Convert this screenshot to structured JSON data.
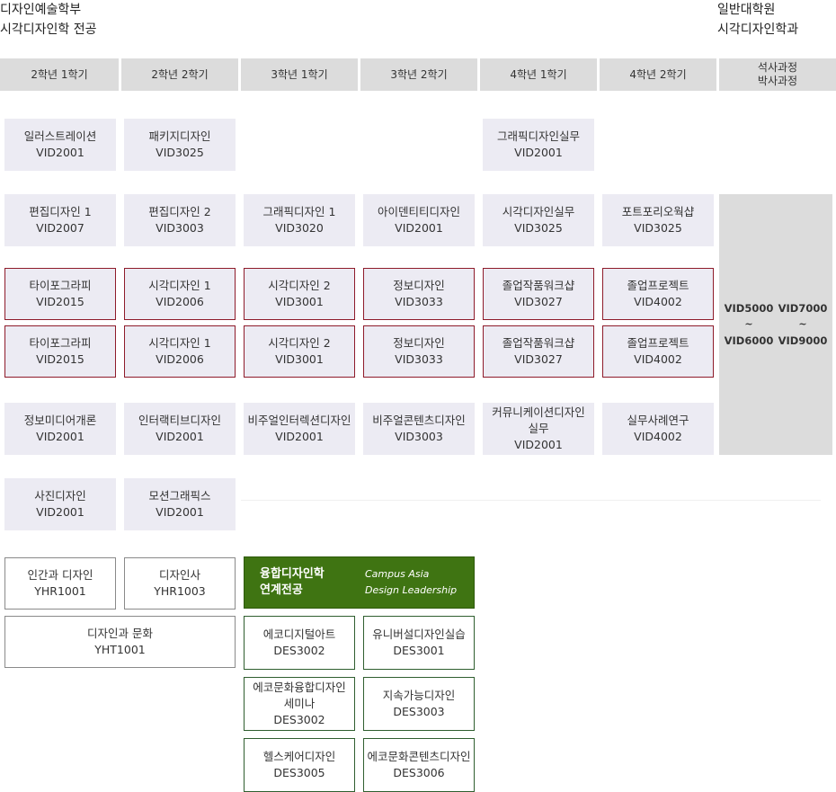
{
  "left_title": {
    "line1": "디자인예술학부",
    "line2": "시각디자인학 전공"
  },
  "right_title": {
    "line1": "일반대학원",
    "line2": "시각디자인학과"
  },
  "headers": [
    "2학년 1학기",
    "2학년 2학기",
    "3학년 1학기",
    "3학년 2학기",
    "4학년 1학기",
    "4학년 2학기"
  ],
  "grad_header": {
    "line1": "석사과정",
    "line2": "박사과정"
  },
  "courses": {
    "illustration": {
      "name": "일러스트레이션",
      "code": "VID2001"
    },
    "package_design": {
      "name": "패키지디자인",
      "code": "VID3025"
    },
    "graphic_design_practice": {
      "name": "그래픽디자인실무",
      "code": "VID2001"
    },
    "editorial_1": {
      "name": "편집디자인 1",
      "code": "VID2007"
    },
    "editorial_2": {
      "name": "편집디자인 2",
      "code": "VID3003"
    },
    "graphic_design_1": {
      "name": "그래픽디자인 1",
      "code": "VID3020"
    },
    "identity_design": {
      "name": "아이덴티티디자인",
      "code": "VID2001"
    },
    "visual_design_practice": {
      "name": "시각디자인실무",
      "code": "VID3025"
    },
    "portfolio_workshop": {
      "name": "포트포리오웍샵",
      "code": "VID3025"
    },
    "typography_a": {
      "name": "타이포그라피",
      "code": "VID2015"
    },
    "visual_design_1a": {
      "name": "시각디자인 1",
      "code": "VID2006"
    },
    "visual_design_2a": {
      "name": "시각디자인 2",
      "code": "VID3001"
    },
    "info_design_a": {
      "name": "정보디자인",
      "code": "VID3033"
    },
    "grad_workshop_a": {
      "name": "졸업작품워크샵",
      "code": "VID3027"
    },
    "grad_project_a": {
      "name": "졸업프로젝트",
      "code": "VID4002"
    },
    "typography_b": {
      "name": "타이포그라피",
      "code": "VID2015"
    },
    "visual_design_1b": {
      "name": "시각디자인 1",
      "code": "VID2006"
    },
    "visual_design_2b": {
      "name": "시각디자인 2",
      "code": "VID3001"
    },
    "info_design_b": {
      "name": "정보디자인",
      "code": "VID3033"
    },
    "grad_workshop_b": {
      "name": "졸업작품워크샵",
      "code": "VID3027"
    },
    "grad_project_b": {
      "name": "졸업프로젝트",
      "code": "VID4002"
    },
    "info_media": {
      "name": "정보미디어개론",
      "code": "VID2001"
    },
    "interactive_design": {
      "name": "인터랙티브디자인",
      "code": "VID2001"
    },
    "visual_interaction": {
      "name": "비주얼인터렉션디자인",
      "code": "VID2001"
    },
    "visual_content": {
      "name": "비주얼콘텐츠디자인",
      "code": "VID3003"
    },
    "communication_design": {
      "name1": "커뮤니케이션디자인",
      "name2": "실무",
      "code": "VID2001"
    },
    "case_study": {
      "name": "실무사례연구",
      "code": "VID4002"
    },
    "photo_design": {
      "name": "사진디자인",
      "code": "VID2001"
    },
    "motion_graphics": {
      "name": "모션그래픽스",
      "code": "VID2001"
    },
    "human_design": {
      "name": "인간과 디자인",
      "code": "YHR1001"
    },
    "design_history": {
      "name": "디자인사",
      "code": "YHR1003"
    },
    "design_culture": {
      "name": "디자인과 문화",
      "code": "YHT1001"
    },
    "eco_digital_art": {
      "name": "에코디지털아트",
      "code": "DES3002"
    },
    "universal_design": {
      "name": "유니버설디자인실습",
      "code": "DES3001"
    },
    "eco_culture_seminar": {
      "name1": "에코문화융합디자인",
      "name2": "세미나",
      "code": "DES3002"
    },
    "sustainable_design": {
      "name": "지속가능디자인",
      "code": "DES3003"
    },
    "healthcare_design": {
      "name": "헬스케어디자인",
      "code": "DES3005"
    },
    "eco_content_design": {
      "name": "에코문화콘텐츠디자인",
      "code": "DES3006"
    }
  },
  "grad_codes": {
    "master_from": "VID5000",
    "master_to": "VID6000",
    "phd_from": "VID7000",
    "phd_to": "VID9000",
    "tilde": "~"
  },
  "convergence": {
    "title_kr_1": "융합디자인학",
    "title_kr_2": "연계전공",
    "title_en_1": "Campus Asia",
    "title_en_2": "Design Leadership"
  },
  "colors": {
    "header_bg": "#dcdcdc",
    "course_bg": "#ecebf3",
    "core_border": "#8e1b2a",
    "convergence_bg": "#3f7412",
    "convergence_border": "#2f5e2f"
  }
}
